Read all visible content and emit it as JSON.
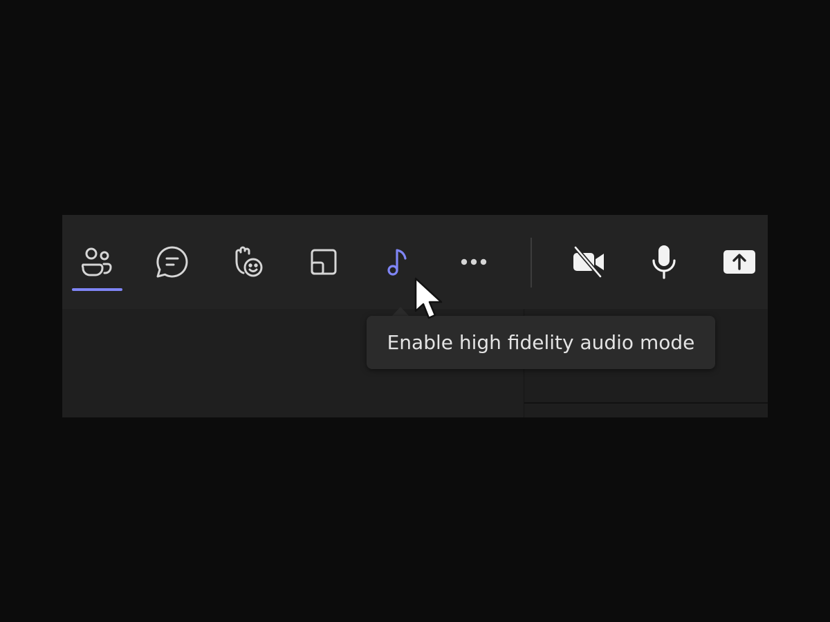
{
  "toolbar": {
    "buttons": [
      {
        "id": "people",
        "icon": "people-icon",
        "active": true
      },
      {
        "id": "chat",
        "icon": "chat-icon"
      },
      {
        "id": "react",
        "icon": "raise-hand-react-icon"
      },
      {
        "id": "view",
        "icon": "view-layout-icon"
      },
      {
        "id": "audio",
        "icon": "music-note-icon",
        "highlighted": true
      },
      {
        "id": "more",
        "icon": "more-options-icon"
      },
      {
        "id": "camera",
        "icon": "camera-off-icon"
      },
      {
        "id": "mic",
        "icon": "microphone-icon"
      },
      {
        "id": "share",
        "icon": "share-screen-icon"
      }
    ]
  },
  "tooltip": {
    "text": "Enable high fidelity audio mode"
  },
  "colors": {
    "accent": "#7f85f5",
    "icon": "#d6d6d6",
    "toolbar_bg": "#232323",
    "content_bg": "#1f1f1f",
    "backdrop": "#0c0c0c"
  }
}
